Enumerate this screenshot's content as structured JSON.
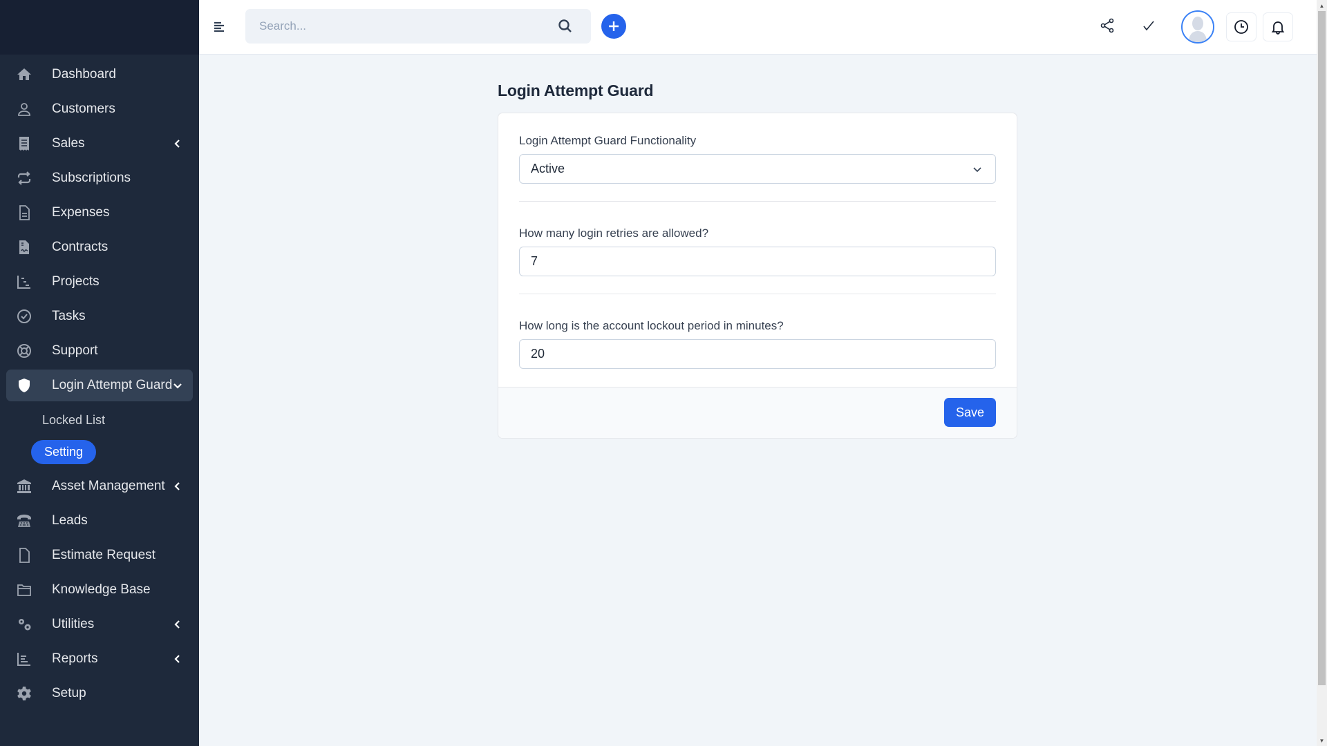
{
  "header": {
    "search_placeholder": "Search...",
    "icons": [
      "menu-toggle-icon",
      "search-icon",
      "plus-icon",
      "share-icon",
      "check-icon",
      "avatar",
      "clock-icon",
      "bell-icon"
    ]
  },
  "sidebar": {
    "items": [
      {
        "label": "Dashboard",
        "icon": "home-icon"
      },
      {
        "label": "Customers",
        "icon": "user-icon"
      },
      {
        "label": "Sales",
        "icon": "receipt-icon",
        "expandable": true
      },
      {
        "label": "Subscriptions",
        "icon": "repeat-icon"
      },
      {
        "label": "Expenses",
        "icon": "file-text-icon"
      },
      {
        "label": "Contracts",
        "icon": "file-signature-icon"
      },
      {
        "label": "Projects",
        "icon": "gantt-icon"
      },
      {
        "label": "Tasks",
        "icon": "check-circle-icon"
      },
      {
        "label": "Support",
        "icon": "life-ring-icon"
      },
      {
        "label": "Login Attempt Guard",
        "icon": "shield-icon",
        "expanded": true,
        "active": true
      },
      {
        "label": "Asset Management",
        "icon": "bank-icon",
        "expandable": true
      },
      {
        "label": "Leads",
        "icon": "phone-icon"
      },
      {
        "label": "Estimate Request",
        "icon": "file-icon"
      },
      {
        "label": "Knowledge Base",
        "icon": "folder-icon"
      },
      {
        "label": "Utilities",
        "icon": "cogs-icon",
        "expandable": true
      },
      {
        "label": "Reports",
        "icon": "bar-chart-icon",
        "expandable": true
      },
      {
        "label": "Setup",
        "icon": "gear-icon"
      }
    ],
    "submenu": [
      {
        "label": "Locked List"
      },
      {
        "label": "Setting",
        "active": true
      }
    ]
  },
  "main": {
    "title": "Login Attempt Guard",
    "fields": [
      {
        "label": "Login Attempt Guard Functionality",
        "type": "select",
        "value": "Active"
      },
      {
        "label": "How many login retries are allowed?",
        "type": "number",
        "value": "7"
      },
      {
        "label": "How long is the account lockout period in minutes?",
        "type": "number",
        "value": "20"
      }
    ],
    "save_label": "Save"
  },
  "colors": {
    "accent": "#2563eb",
    "sidebar_bg": "#1e293b",
    "page_bg": "#f1f5f9"
  }
}
